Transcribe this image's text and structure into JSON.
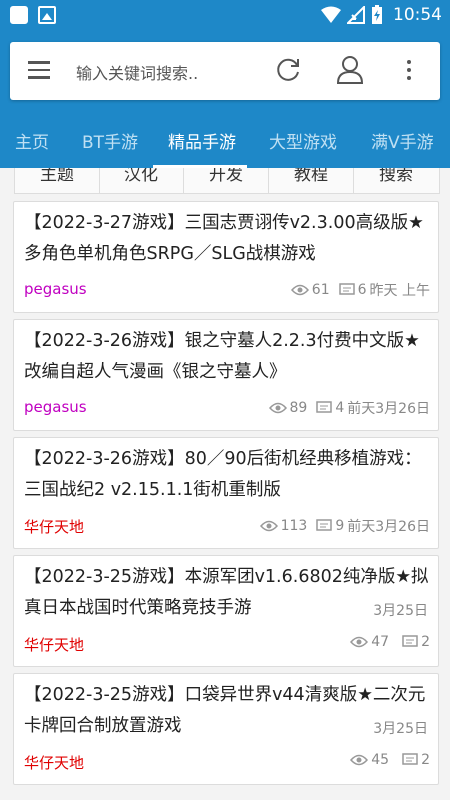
{
  "status": {
    "time": "10:54"
  },
  "search": {
    "placeholder": "输入关键词搜索.."
  },
  "tabs": [
    {
      "label": "主页"
    },
    {
      "label": "BT手游"
    },
    {
      "label": "精品手游"
    },
    {
      "label": "大型游戏"
    },
    {
      "label": "满V手游"
    }
  ],
  "subcats": [
    {
      "label": "主题"
    },
    {
      "label": "汉化"
    },
    {
      "label": "开发"
    },
    {
      "label": "教程"
    },
    {
      "label": "搜索"
    }
  ],
  "colors": {
    "accent": "#1e88c8",
    "author_purple": "#c000c0",
    "author_red": "#e00000"
  },
  "posts": [
    {
      "title": "【2022-3-27游戏】三国志贾诩传v2.3.00高级版★多角色单机角色SRPG／SLG战棋游戏",
      "author": "pegasus",
      "views": "61",
      "replies": "6",
      "time": "昨天 上午"
    },
    {
      "title": "【2022-3-26游戏】银之守墓人2.2.3付费中文版★改编自超人气漫画《银之守墓人》",
      "author": "pegasus",
      "views": "89",
      "replies": "4",
      "time": "前天3月26日"
    },
    {
      "title": "【2022-3-26游戏】80／90后街机经典移植游戏：三国战纪2 v2.15.1.1街机重制版",
      "author": "华仔天地",
      "views": "113",
      "replies": "9",
      "time": "前天3月26日"
    },
    {
      "title": "【2022-3-25游戏】本源军团v1.6.6802纯净版★拟真日本战国时代策略竞技手游",
      "author": "华仔天地",
      "views": "47",
      "replies": "2",
      "time": "3月25日"
    },
    {
      "title": "【2022-3-25游戏】口袋异世界v44清爽版★二次元卡牌回合制放置游戏",
      "author": "华仔天地",
      "views": "45",
      "replies": "2",
      "time": "3月25日"
    }
  ]
}
